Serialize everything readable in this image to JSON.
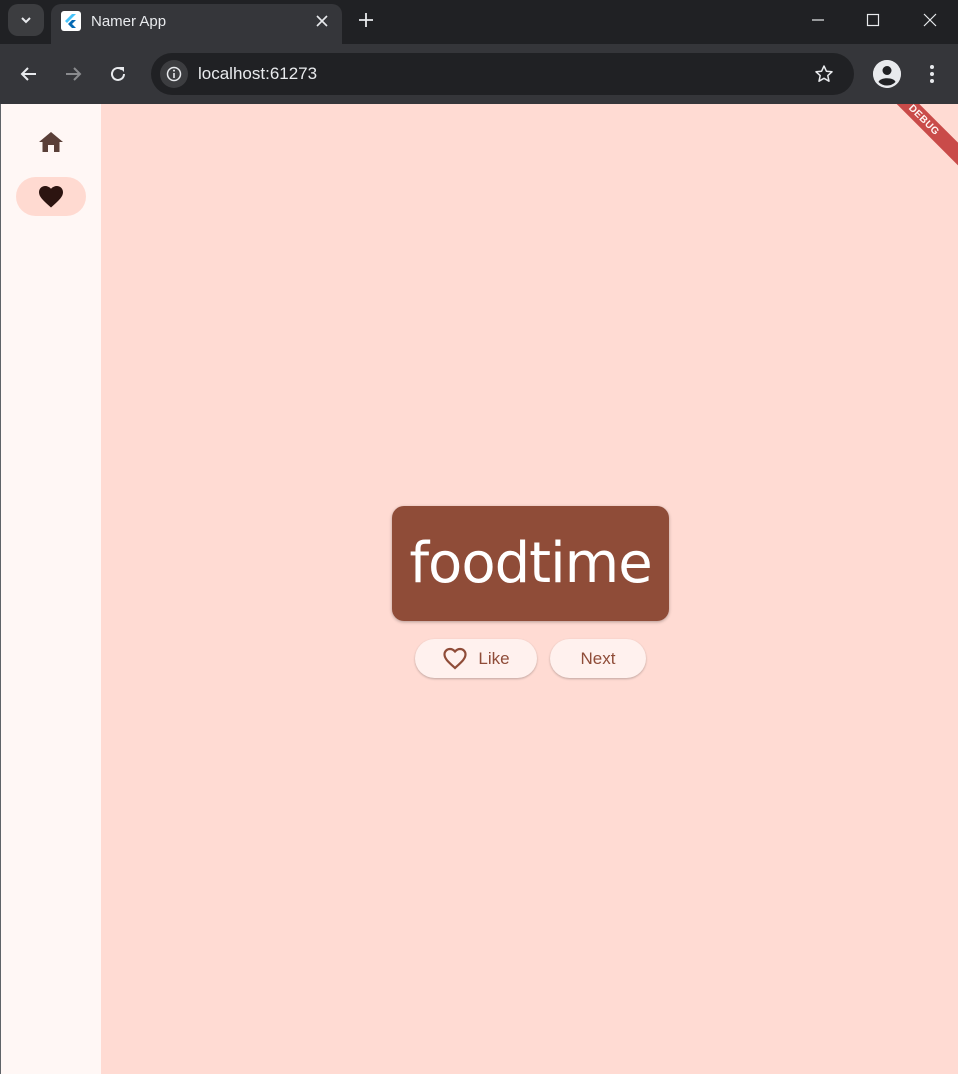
{
  "browser": {
    "tab": {
      "title": "Namer App"
    },
    "url": "localhost:61273"
  },
  "icons": {
    "tab_search": "chevron-down-icon",
    "tab_favicon": "flutter-logo-icon",
    "tab_close": "close-icon",
    "new_tab": "plus-icon",
    "minimize": "minimize-icon",
    "maximize": "maximize-icon",
    "close_window": "close-icon",
    "back": "arrow-left-icon",
    "forward": "arrow-right-icon",
    "reload": "reload-icon",
    "site_info": "info-icon",
    "bookmark": "star-outline-icon",
    "profile": "person-icon",
    "menu": "kebab-menu-icon",
    "rail_home": "home-icon",
    "rail_favorites": "heart-filled-icon",
    "like": "heart-outline-icon"
  },
  "app": {
    "rail": {
      "items": [
        {
          "id": "home",
          "selected": false
        },
        {
          "id": "favorites",
          "selected": true
        }
      ]
    },
    "word": "foodtime",
    "buttons": {
      "like": "Like",
      "next": "Next"
    },
    "debug_banner": "DEBUG"
  },
  "colors": {
    "chrome_dark": "#202124",
    "chrome_toolbar": "#35363a",
    "rail_bg": "#fff7f5",
    "main_bg": "#ffdbd3",
    "card": "#8f4c38",
    "button_bg": "#fff1ee",
    "rail_selected": "#ffdad1",
    "debug": "#b71c1c"
  }
}
